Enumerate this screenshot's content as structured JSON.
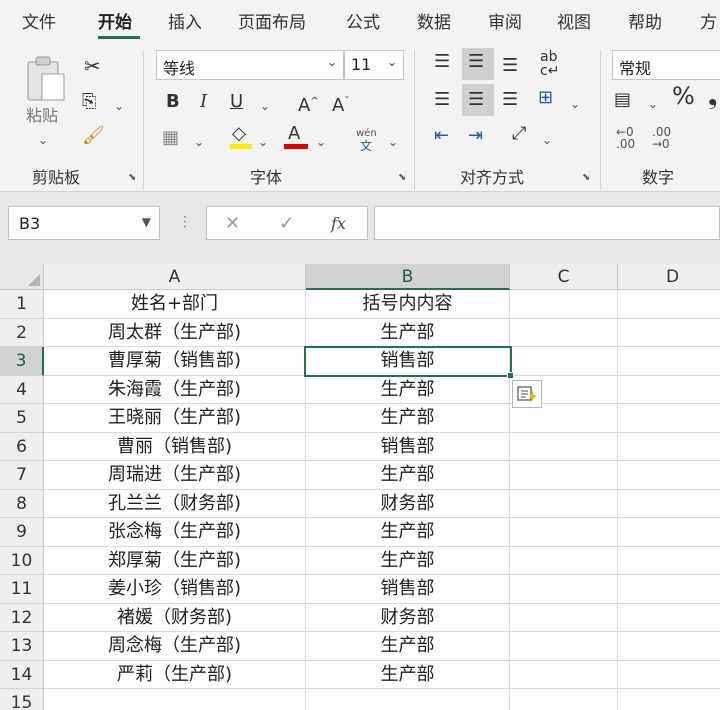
{
  "tabs": [
    "文件",
    "开始",
    "插入",
    "页面布局",
    "公式",
    "数据",
    "审阅",
    "视图",
    "帮助",
    "方"
  ],
  "active_tab": "开始",
  "clipboard": {
    "paste_label": "粘贴",
    "group_label": "剪贴板"
  },
  "font": {
    "name": "等线",
    "size": "11",
    "group_label": "字体",
    "phonetic": "wén"
  },
  "alignment": {
    "group_label": "对齐方式"
  },
  "number": {
    "format": "常规",
    "percent": "%",
    "group_label": "数字"
  },
  "formula_bar": {
    "name_box": "B3",
    "value": ""
  },
  "columns": [
    "A",
    "B",
    "C",
    "D"
  ],
  "selected_cell": {
    "col": "B",
    "row": "3"
  },
  "rows": [
    {
      "n": "1",
      "a": "姓名+部门",
      "b": "括号内内容"
    },
    {
      "n": "2",
      "a": "周太群（生产部)",
      "b": "生产部"
    },
    {
      "n": "3",
      "a": "曹厚菊（销售部)",
      "b": "销售部"
    },
    {
      "n": "4",
      "a": "朱海霞（生产部)",
      "b": "生产部"
    },
    {
      "n": "5",
      "a": "王晓丽（生产部)",
      "b": "生产部"
    },
    {
      "n": "6",
      "a": "曹丽（销售部)",
      "b": "销售部"
    },
    {
      "n": "7",
      "a": "周瑞进（生产部)",
      "b": "生产部"
    },
    {
      "n": "8",
      "a": "孔兰兰（财务部)",
      "b": "财务部"
    },
    {
      "n": "9",
      "a": "张念梅（生产部)",
      "b": "生产部"
    },
    {
      "n": "10",
      "a": "郑厚菊（生产部)",
      "b": "生产部"
    },
    {
      "n": "11",
      "a": "姜小珍（销售部)",
      "b": "销售部"
    },
    {
      "n": "12",
      "a": "褚媛（财务部)",
      "b": "财务部"
    },
    {
      "n": "13",
      "a": "周念梅（生产部)",
      "b": "生产部"
    },
    {
      "n": "14",
      "a": "严莉（生产部)",
      "b": "生产部"
    },
    {
      "n": "15",
      "a": "",
      "b": ""
    }
  ],
  "colors": {
    "accent": "#217346",
    "font_highlight": "#ffeb00",
    "font_color": "#e00000"
  }
}
